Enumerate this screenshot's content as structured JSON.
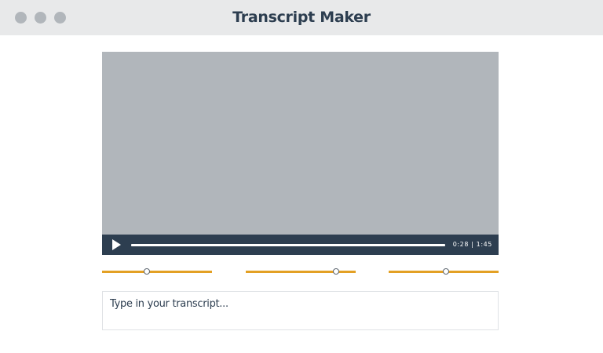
{
  "window": {
    "title": "Transcript Maker",
    "controls": [
      "window-dot",
      "window-dot",
      "window-dot"
    ]
  },
  "player": {
    "play_icon": "play-icon",
    "time_readout": "0:28 | 1:45",
    "current_time": "0:28",
    "duration": "1:45"
  },
  "sliders": [
    {
      "value": 0.41
    },
    {
      "value": 0.82
    },
    {
      "value": 0.52
    }
  ],
  "transcript": {
    "placeholder": "Type in your transcript..."
  },
  "colors": {
    "titlebar_bg": "#e8e9ea",
    "window_dot": "#b1b6bb",
    "title_text": "#2d3e50",
    "video_area": "#b1b6bb",
    "controls_bar": "#2d3e50",
    "slider_accent": "#e3a024",
    "input_border": "#dfe2e5"
  }
}
